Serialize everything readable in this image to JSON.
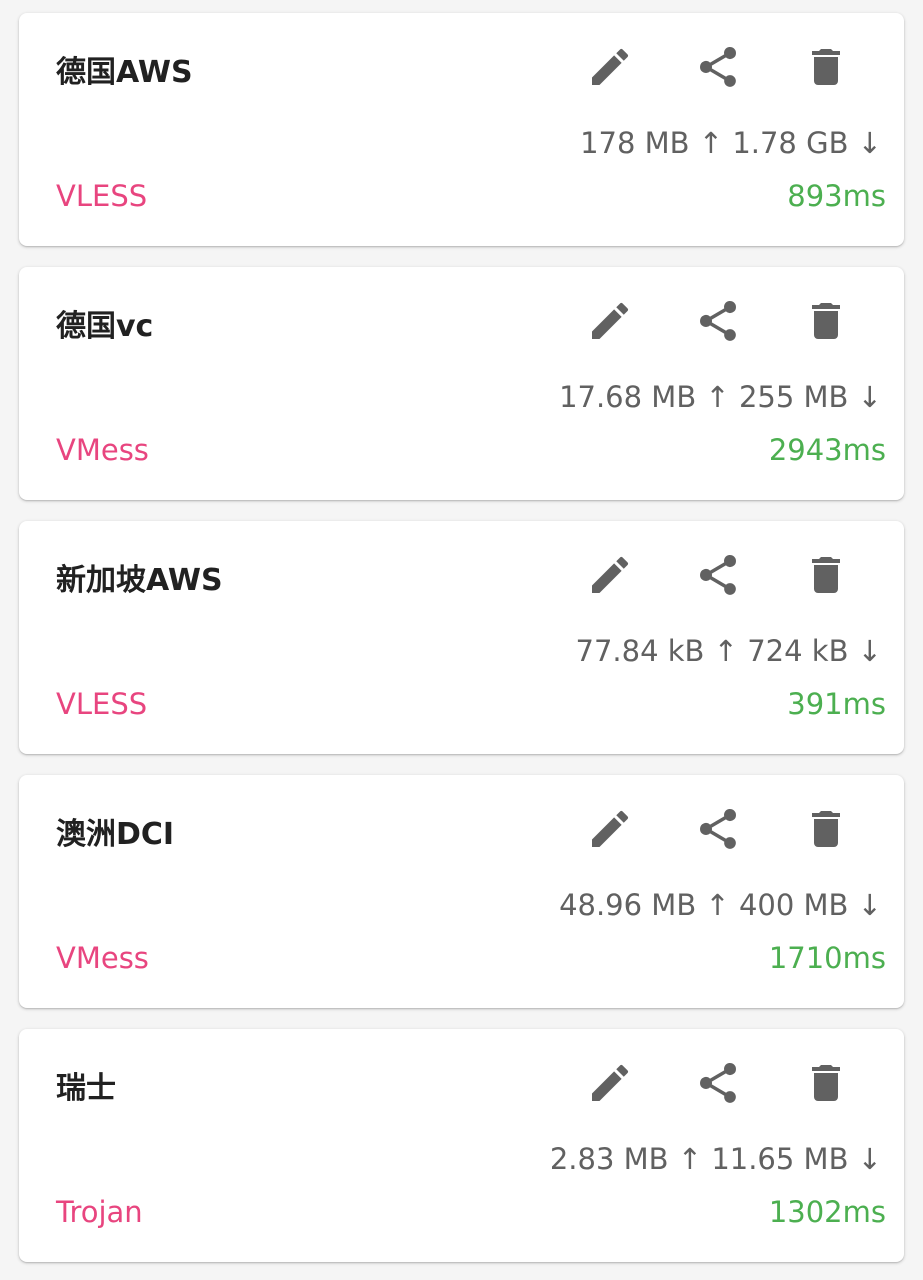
{
  "colors": {
    "protocol": "#e8457f",
    "latency": "#4caf50",
    "icon": "#616161"
  },
  "icons": {
    "edit": "pencil-icon",
    "share": "share-icon",
    "delete": "trash-icon"
  },
  "servers": [
    {
      "name": "德国AWS",
      "upload": "178 MB",
      "download": "1.78 GB",
      "protocol": "VLESS",
      "latency": "893ms"
    },
    {
      "name": "德国vc",
      "upload": "17.68 MB",
      "download": "255 MB",
      "protocol": "VMess",
      "latency": "2943ms"
    },
    {
      "name": "新加坡AWS",
      "upload": "77.84 kB",
      "download": "724 kB",
      "protocol": "VLESS",
      "latency": "391ms"
    },
    {
      "name": "澳洲DCI",
      "upload": "48.96 MB",
      "download": "400 MB",
      "protocol": "VMess",
      "latency": "1710ms"
    },
    {
      "name": "瑞士",
      "upload": "2.83 MB",
      "download": "11.65 MB",
      "protocol": "Trojan",
      "latency": "1302ms"
    }
  ]
}
